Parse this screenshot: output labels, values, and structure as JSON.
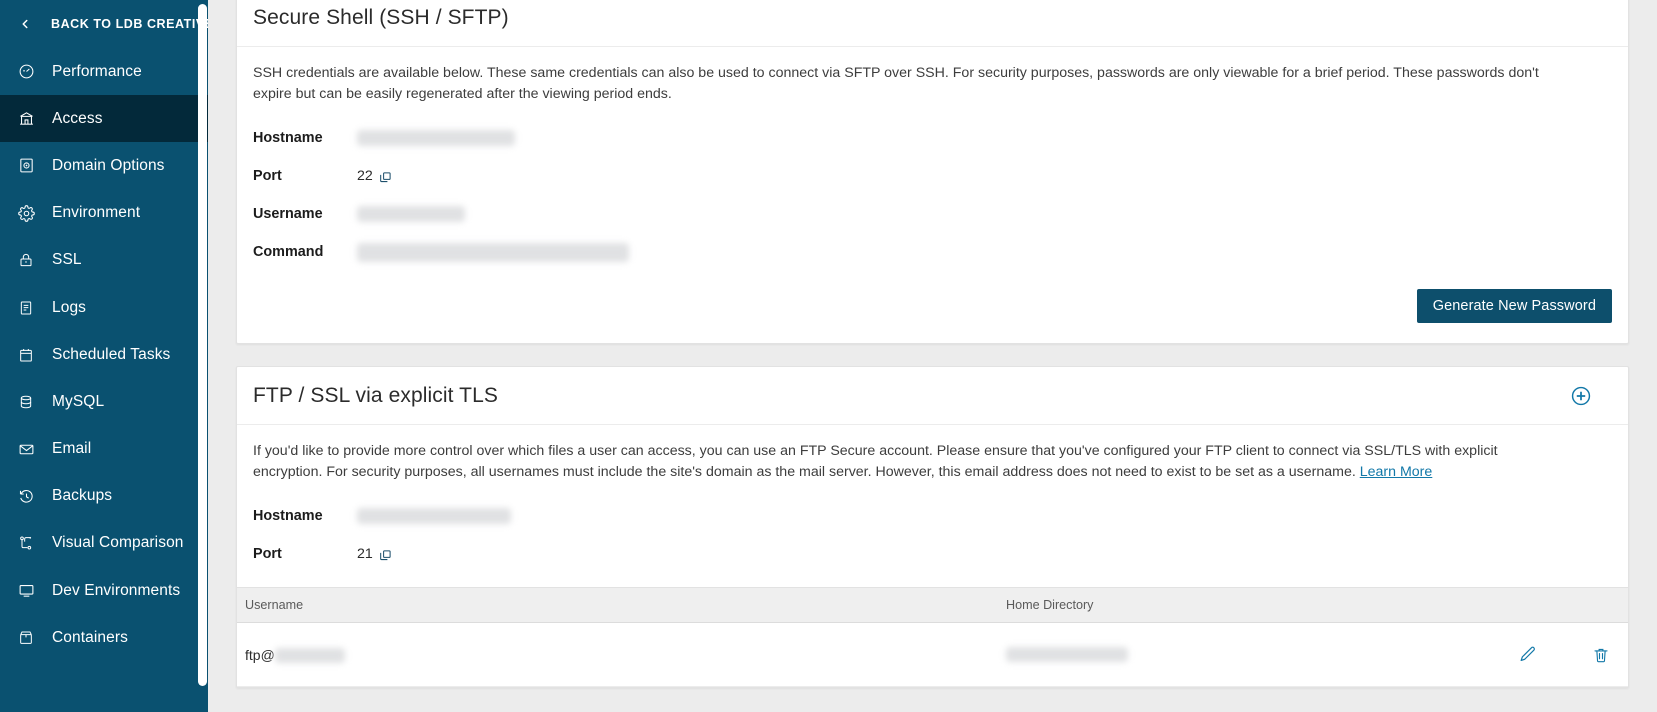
{
  "sidebar": {
    "back": {
      "label": "BACK TO LDB CREATIVE",
      "icon": "chevron-left-icon"
    },
    "items": [
      {
        "label": "Performance",
        "icon": "gauge-icon",
        "active": false
      },
      {
        "label": "Access",
        "icon": "bank-icon",
        "active": true
      },
      {
        "label": "Domain Options",
        "icon": "globe-box-icon",
        "active": false
      },
      {
        "label": "Environment",
        "icon": "gear-icon",
        "active": false
      },
      {
        "label": "SSL",
        "icon": "lock-icon",
        "active": false
      },
      {
        "label": "Logs",
        "icon": "document-icon",
        "active": false
      },
      {
        "label": "Scheduled Tasks",
        "icon": "calendar-icon",
        "active": false
      },
      {
        "label": "MySQL",
        "icon": "database-icon",
        "active": false
      },
      {
        "label": "Email",
        "icon": "envelope-icon",
        "active": false
      },
      {
        "label": "Backups",
        "icon": "history-icon",
        "active": false
      },
      {
        "label": "Visual Comparison",
        "icon": "compare-icon",
        "active": false
      },
      {
        "label": "Dev Environments",
        "icon": "monitor-icon",
        "active": false
      },
      {
        "label": "Containers",
        "icon": "container-icon",
        "active": false
      }
    ],
    "accent_color": "#0a5170",
    "active_color": "#03293a"
  },
  "ssh": {
    "title": "Secure Shell (SSH / SFTP)",
    "description": "SSH credentials are available below. These same credentials can also be used to connect via SFTP over SSH. For security purposes, passwords are only viewable for a brief period. These passwords don't expire but can be easily regenerated after the viewing period ends.",
    "fields": [
      {
        "key": "Hostname",
        "value": "",
        "redacted": true,
        "copyable": false
      },
      {
        "key": "Port",
        "value": "22",
        "redacted": false,
        "copyable": true
      },
      {
        "key": "Username",
        "value": "",
        "redacted": true,
        "copyable": false
      },
      {
        "key": "Command",
        "value": "",
        "redacted": true,
        "copyable": false
      }
    ],
    "generate_button": "Generate New Password"
  },
  "ftp": {
    "title": "FTP / SSL via explicit TLS",
    "add_icon": "plus-circle-icon",
    "description_part1": "If you'd like to provide more control over which files a user can access, you can use an FTP Secure account. Please ensure that you've configured your FTP client to connect via SSL/TLS with explicit encryption. For security purposes, all usernames must include the site's domain as the mail server. However, this email address does not need to exist to be set as a username. ",
    "learn_more": "Learn More",
    "fields": [
      {
        "key": "Hostname",
        "value": "",
        "redacted": true,
        "copyable": false
      },
      {
        "key": "Port",
        "value": "21",
        "redacted": false,
        "copyable": true
      }
    ],
    "table": {
      "columns": [
        "Username",
        "Home Directory"
      ],
      "rows": [
        {
          "username_prefix": "ftp@",
          "username_redacted": true,
          "home_directory_redacted": true,
          "actions": [
            "edit-icon",
            "delete-icon"
          ]
        }
      ]
    }
  },
  "colors": {
    "sidebar": "#0a5170",
    "sidebar_active": "#03293a",
    "link": "#1278a8",
    "button": "#0d4f6c",
    "page_bg": "#ececec"
  }
}
